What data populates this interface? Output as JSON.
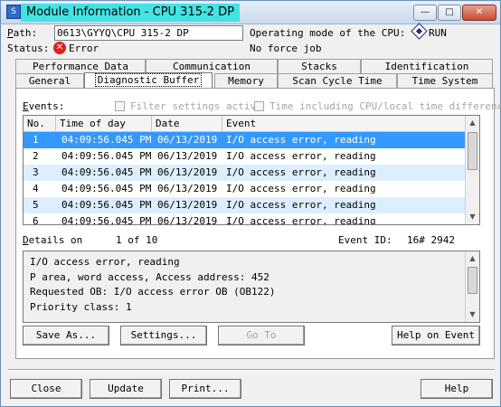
{
  "window": {
    "title": "Module Information - CPU 315-2 DP",
    "controls": {
      "minimize": "—",
      "maximize": "□",
      "close": "✕"
    }
  },
  "header": {
    "path_label": "Path:",
    "path_value": "0613\\GYYQ\\CPU 315-2 DP",
    "status_label": "Status:",
    "status_value": "Error",
    "mode_label": "Operating mode of the  CPU:",
    "mode_value": "RUN",
    "force_text": "No force job"
  },
  "tabs_top": [
    "Performance Data",
    "Communication",
    "Stacks",
    "Identification"
  ],
  "tabs_bottom": [
    "General",
    "Diagnostic Buffer",
    "Memory",
    "Scan Cycle Time",
    "Time System"
  ],
  "active_tab": "Diagnostic Buffer",
  "events": {
    "label": "Events:",
    "filter_label": "Filter settings activ",
    "time_label": "Time including CPU/local time differenc",
    "columns": [
      "No.",
      "Time of day",
      "Date",
      "Event"
    ],
    "rows": [
      {
        "no": "1",
        "time": "04:09:56.045 PM",
        "date": "06/13/2019",
        "event": "I/O access error, reading"
      },
      {
        "no": "2",
        "time": "04:09:56.045 PM",
        "date": "06/13/2019",
        "event": "I/O access error, reading"
      },
      {
        "no": "3",
        "time": "04:09:56.045 PM",
        "date": "06/13/2019",
        "event": "I/O access error, reading"
      },
      {
        "no": "4",
        "time": "04:09:56.045 PM",
        "date": "06/13/2019",
        "event": "I/O access error, reading"
      },
      {
        "no": "5",
        "time": "04:09:56.045 PM",
        "date": "06/13/2019",
        "event": "I/O access error, reading"
      },
      {
        "no": "6",
        "time": "04:09:56.045 PM",
        "date": "06/13/2019",
        "event": "I/O access error, reading"
      }
    ],
    "selected_row": 1
  },
  "details": {
    "label": "Details on",
    "count": "1 of 10",
    "event_id_label": "Event ID:",
    "event_id_value": "16# 2942",
    "lines": [
      "I/O access error, reading",
      "P area, word access, Access address:     452",
      "Requested OB: I/O access error OB (OB122)",
      "Priority class:  1"
    ]
  },
  "buttons": {
    "save_as": "Save As...",
    "settings": "Settings...",
    "go_to": "Go To",
    "help_on_event": "Help on Event",
    "close": "Close",
    "update": "Update",
    "print": "Print...",
    "help": "Help"
  },
  "colors": {
    "selection": "#3399ff",
    "alt_row": "#ddeeff",
    "title_highlight": "#44e3e3",
    "error": "#e02020"
  }
}
